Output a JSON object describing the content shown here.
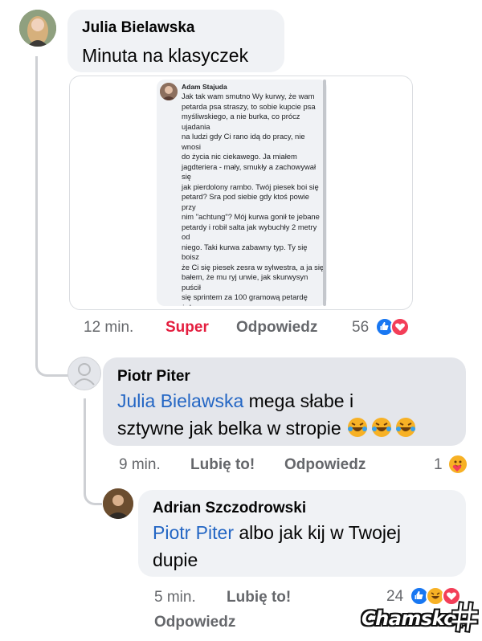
{
  "comment1": {
    "author": "Julia Bielawska",
    "text": "Minuta na klasyczek",
    "image": {
      "author": "Adam Stajuda",
      "text": "Jak tak wam smutno Wy kurwy, że wam\npetarda psa straszy, to sobie kupcie psa\nmyśliwskiego, a nie burka, co prócz ujadania\nna ludzi gdy Ci rano idą do pracy, nie wnosi\ndo życia nic ciekawego. Ja miałem\njagdteriera - mały, smukły a zachowywał się\njak pierdolony rambo. Twój piesek boi się\npetard? Sra pod siebie gdy ktoś powie przy\nnim \"achtung\"? Mój kurwa gonił te jebane\npetardy i robił salta jak wybuchły 2 metry od\nniego. Taki kurwa zabawny typ. Ty się boisz\nże Ci się piesek zesra w sylwestra, a ja się\nbałem, że mu ryj urwie, jak skurwysyn puścił\nsię sprintem za 100 gramową petardę żeby\nją dojebać zanim wybuchnie. Czym Ty się\nmożesz pochwalić? Że twój piesek ładniej\nwygląda? Mój też ładnie wyglądał -\nszczególnie gdy kurwa nasmarował pysk\nbarwami wojennymi, schował szable pod\nskórę, kilka granatów w łapie i obwieścił, że\nidzie spuszczać wpierdol, chędożyć i nie wie\nkiedy wraca. Jeszcze potem wracał i flaszke\nstawiał. To jest kurwa pies, a nie Kajtek, co\numie jedynie żreć Pedigree, srać i chować\nsię pod sofę na dźwięk eksplozji piratki.\nZapamiętaj to sobie."
    },
    "time": "12 min.",
    "reaction_label": "Super",
    "reply_label": "Odpowiedz",
    "reaction_count": "56"
  },
  "comment2": {
    "author": "Piotr Piter",
    "mention": "Julia Bielawska",
    "text_line1": " mega słabe i",
    "text_line2": "sztywne jak belka w stropie",
    "emojis": [
      "laughing-emoji",
      "laughing-emoji",
      "laughing-emoji"
    ],
    "time": "9 min.",
    "like_label": "Lubię to!",
    "reply_label": "Odpowiedz",
    "reaction_count": "1"
  },
  "comment3": {
    "author": "Adrian Szczodrowski",
    "mention": "Piotr Piter",
    "text_line1": " albo jak kij w Twojej",
    "text_line2": "dupie",
    "time": "5 min.",
    "like_label": "Lubię to!",
    "reply_label": "Odpowiedz",
    "reaction_count": "24"
  },
  "watermark": {
    "text": "Chamsko",
    "suffix": ".pl"
  },
  "colors": {
    "like": "#1877f2",
    "love": "#f33e58",
    "haha": "#f7b125",
    "mention": "#2366c4",
    "super": "#e41e3f"
  }
}
